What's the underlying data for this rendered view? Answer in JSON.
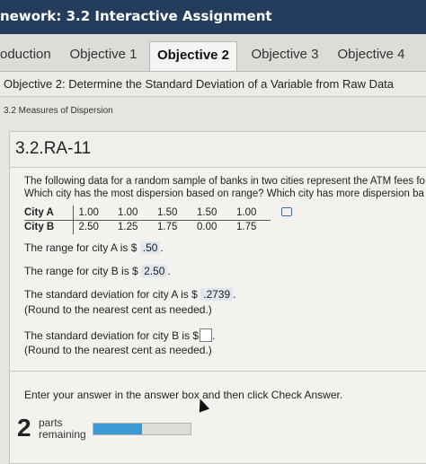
{
  "header": {
    "title": "nework: 3.2 Interactive Assignment"
  },
  "tabs": [
    {
      "label": "oduction",
      "active": false
    },
    {
      "label": "Objective 1",
      "active": false
    },
    {
      "label": "Objective 2",
      "active": true
    },
    {
      "label": "Objective 3",
      "active": false
    },
    {
      "label": "Objective 4",
      "active": false
    }
  ],
  "objective": {
    "text": "Objective 2: Determine the Standard Deviation of a Variable from Raw Data"
  },
  "section": {
    "label": "3.2 Measures of Dispersion"
  },
  "problem": {
    "id": "3.2.RA-11",
    "intro_line1": "The following data for a random sample of banks in two cities represent the ATM fees fo",
    "intro_line2": "Which city has the most dispersion based on range? Which city has more dispersion ba",
    "table": {
      "rows": [
        {
          "label": "City A",
          "values": [
            "1.00",
            "1.00",
            "1.50",
            "1.50",
            "1.00"
          ]
        },
        {
          "label": "City B",
          "values": [
            "2.50",
            "1.25",
            "1.75",
            "0.00",
            "1.75"
          ]
        }
      ]
    },
    "range_a": {
      "prefix": "The range for city A is $",
      "answer": ".50",
      "suffix": "."
    },
    "range_b": {
      "prefix": "The range for city B is $",
      "answer": "2.50",
      "suffix": "."
    },
    "sd_a": {
      "prefix": "The standard deviation for city A is $",
      "answer": ".2739",
      "suffix": ".",
      "note": "(Round to the nearest cent as needed.)"
    },
    "sd_b": {
      "prefix": "The standard deviation for city B is $",
      "suffix": ".",
      "note": "(Round to the nearest cent as needed.)"
    }
  },
  "footer": {
    "instruction": "Enter your answer in the answer box and then click Check Answer.",
    "parts_count": "2",
    "parts_line1": "parts",
    "parts_line2": "remaining",
    "progress_fraction": 0.5
  },
  "colors": {
    "header_bg": "#243d5c",
    "answer_highlight": "#dfe6ee",
    "progress": "#3b9ad3"
  }
}
